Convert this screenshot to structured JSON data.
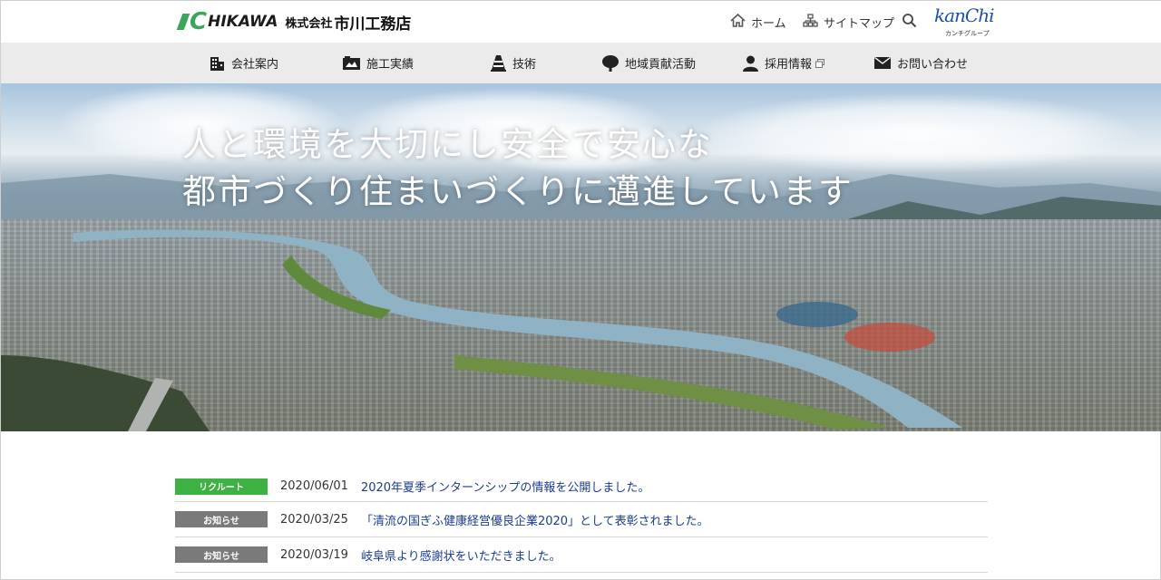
{
  "header": {
    "logo_en": "HIKAWA",
    "logo_jp_small": "株式会社",
    "logo_jp": "市川工務店",
    "home_label": "ホーム",
    "sitemap_label": "サイトマップ",
    "group_logo_text": "kanChi",
    "group_logo_sub": "カンチグループ"
  },
  "nav": {
    "items": [
      {
        "label": "会社案内",
        "icon": "building-icon"
      },
      {
        "label": "施工実績",
        "icon": "photo-icon"
      },
      {
        "label": "技術",
        "icon": "cone-icon"
      },
      {
        "label": "地域貢献活動",
        "icon": "tree-icon"
      },
      {
        "label": "採用情報",
        "icon": "person-icon"
      },
      {
        "label": "お問い合わせ",
        "icon": "mail-icon"
      }
    ]
  },
  "hero": {
    "line1": "人と環境を大切にし安全で安心な",
    "line2": "都市づくり住まいづくりに邁進しています"
  },
  "news": [
    {
      "category": "リクルート",
      "color": "#3db142",
      "date": "2020/06/01",
      "title": "2020年夏季インターンシップの情報を公開しました。"
    },
    {
      "category": "お知らせ",
      "color": "#7a7a7a",
      "date": "2020/03/25",
      "title": "「清流の国ぎふ健康経営優良企業2020」として表彰されました。"
    },
    {
      "category": "お知らせ",
      "color": "#7a7a7a",
      "date": "2020/03/19",
      "title": "岐阜県より感謝状をいただきました。"
    }
  ]
}
